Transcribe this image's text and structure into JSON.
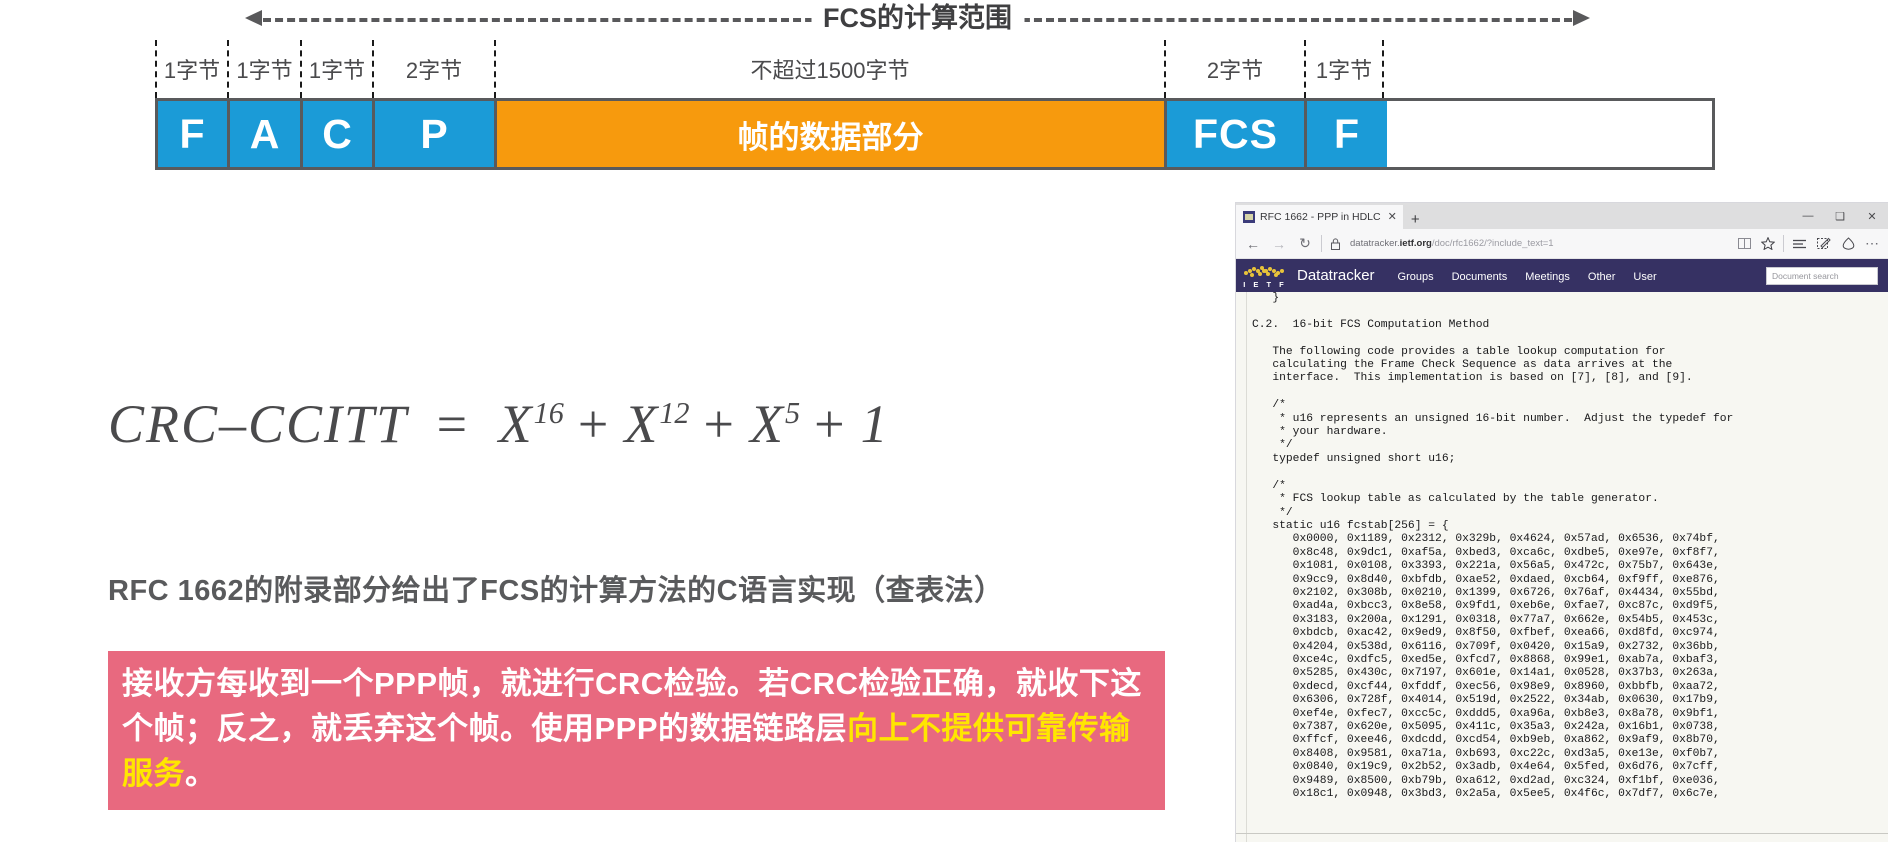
{
  "slide": {
    "frame_diagram": {
      "span_label": "FCS的计算范围",
      "byte_labels": [
        "1字节",
        "1字节",
        "1字节",
        "2字节",
        "不超过1500字节",
        "2字节",
        "1字节"
      ],
      "fields": [
        {
          "label": "F",
          "color": "#1b9bd7",
          "script": "latin"
        },
        {
          "label": "A",
          "color": "#1b9bd7",
          "script": "latin"
        },
        {
          "label": "C",
          "color": "#1b9bd7",
          "script": "latin"
        },
        {
          "label": "P",
          "color": "#1b9bd7",
          "script": "latin"
        },
        {
          "label": "帧的数据部分",
          "color": "#f79a0d",
          "script": "cjk"
        },
        {
          "label": "FCS",
          "color": "#1b9bd7",
          "script": "latin"
        },
        {
          "label": "F",
          "color": "#1b9bd7",
          "script": "latin"
        }
      ],
      "colors": {
        "blue": "#1b9bd7",
        "orange": "#f79a0d",
        "outline": "#595a5c",
        "dash": "#59595b"
      }
    },
    "crc_formula": {
      "lhs": "CRC–CCITT",
      "equals": "=",
      "terms": [
        {
          "base": "X",
          "exp": "16"
        },
        {
          "base": "X",
          "exp": "12"
        },
        {
          "base": "X",
          "exp": "5"
        },
        {
          "base": "1",
          "exp": ""
        }
      ],
      "plus": "+"
    },
    "rfc_heading": "RFC 1662的附录部分给出了FCS的计算方法的C语言实现（查表法）",
    "callout": {
      "part1": "接收方每收到一个PPP帧，就进行CRC检验。若CRC检验正确，就收下这个帧；反之，就丢弃这个帧。使用PPP的数据链路层",
      "highlight": "向上不提供可靠传输服务",
      "part2": "。",
      "bg_color": "#e8697f",
      "highlight_color": "#ffe600"
    }
  },
  "browser": {
    "tab": {
      "title": "RFC 1662 - PPP in HDLC",
      "close_glyph": "✕",
      "favicon_name": "ietf-favicon"
    },
    "new_tab_glyph": "+",
    "window_controls": [
      {
        "name": "minimize-button",
        "glyph": "―"
      },
      {
        "name": "maximize-button",
        "glyph": "❑"
      },
      {
        "name": "close-button",
        "glyph": "✕"
      }
    ],
    "nav": {
      "back_glyph": "←",
      "forward_glyph": "→",
      "refresh_glyph": "↻",
      "url_prefix": "datatracker.",
      "url_host": "ietf.org",
      "url_path": "/doc/rfc1662/?include_text=1",
      "lock_name": "lock-icon"
    },
    "toolbar_right": [
      {
        "name": "reading-view-icon",
        "glyph": "❏"
      },
      {
        "name": "favorites-star-icon",
        "glyph": "☆"
      },
      {
        "name": "hub-icon",
        "glyph": "≡"
      },
      {
        "name": "web-note-icon",
        "glyph": "✎"
      },
      {
        "name": "share-icon",
        "glyph": "⌂"
      },
      {
        "name": "more-settings-icon",
        "glyph": "⋯"
      }
    ],
    "ietf_header": {
      "logo_letters": "I E T F",
      "brand": "Datatracker",
      "nav_items": [
        "Groups",
        "Documents",
        "Meetings",
        "Other",
        "User"
      ],
      "search_placeholder": "Document search",
      "bar_color": "#363163"
    },
    "document": {
      "lines": [
        "   }",
        "",
        "C.2.  16-bit FCS Computation Method",
        "",
        "   The following code provides a table lookup computation for",
        "   calculating the Frame Check Sequence as data arrives at the",
        "   interface.  This implementation is based on [7], [8], and [9].",
        "",
        "   /*",
        "    * u16 represents an unsigned 16-bit number.  Adjust the typedef for",
        "    * your hardware.",
        "    */",
        "   typedef unsigned short u16;",
        "",
        "   /*",
        "    * FCS lookup table as calculated by the table generator.",
        "    */",
        "   static u16 fcstab[256] = {",
        "      0x0000, 0x1189, 0x2312, 0x329b, 0x4624, 0x57ad, 0x6536, 0x74bf,",
        "      0x8c48, 0x9dc1, 0xaf5a, 0xbed3, 0xca6c, 0xdbe5, 0xe97e, 0xf8f7,",
        "      0x1081, 0x0108, 0x3393, 0x221a, 0x56a5, 0x472c, 0x75b7, 0x643e,",
        "      0x9cc9, 0x8d40, 0xbfdb, 0xae52, 0xdaed, 0xcb64, 0xf9ff, 0xe876,",
        "      0x2102, 0x308b, 0x0210, 0x1399, 0x6726, 0x76af, 0x4434, 0x55bd,",
        "      0xad4a, 0xbcc3, 0x8e58, 0x9fd1, 0xeb6e, 0xfae7, 0xc87c, 0xd9f5,",
        "      0x3183, 0x200a, 0x1291, 0x0318, 0x77a7, 0x662e, 0x54b5, 0x453c,",
        "      0xbdcb, 0xac42, 0x9ed9, 0x8f50, 0xfbef, 0xea66, 0xd8fd, 0xc974,",
        "      0x4204, 0x538d, 0x6116, 0x709f, 0x0420, 0x15a9, 0x2732, 0x36bb,",
        "      0xce4c, 0xdfc5, 0xed5e, 0xfcd7, 0x8868, 0x99e1, 0xab7a, 0xbaf3,",
        "      0x5285, 0x430c, 0x7197, 0x601e, 0x14a1, 0x0528, 0x37b3, 0x263a,",
        "      0xdecd, 0xcf44, 0xfddf, 0xec56, 0x98e9, 0x8960, 0xbbfb, 0xaa72,",
        "      0x6306, 0x728f, 0x4014, 0x519d, 0x2522, 0x34ab, 0x0630, 0x17b9,",
        "      0xef4e, 0xfec7, 0xcc5c, 0xddd5, 0xa96a, 0xb8e3, 0x8a78, 0x9bf1,",
        "      0x7387, 0x620e, 0x5095, 0x411c, 0x35a3, 0x242a, 0x16b1, 0x0738,",
        "      0xffcf, 0xee46, 0xdcdd, 0xcd54, 0xb9eb, 0xa862, 0x9af9, 0x8b70,",
        "      0x8408, 0x9581, 0xa71a, 0xb693, 0xc22c, 0xd3a5, 0xe13e, 0xf0b7,",
        "      0x0840, 0x19c9, 0x2b52, 0x3adb, 0x4e64, 0x5fed, 0x6d76, 0x7cff,",
        "      0x9489, 0x8500, 0xb79b, 0xa612, 0xd2ad, 0xc324, 0xf1bf, 0xe036,",
        "      0x18c1, 0x0948, 0x3bd3, 0x2a5a, 0x5ee5, 0x4f6c, 0x7df7, 0x6c7e,"
      ]
    }
  }
}
